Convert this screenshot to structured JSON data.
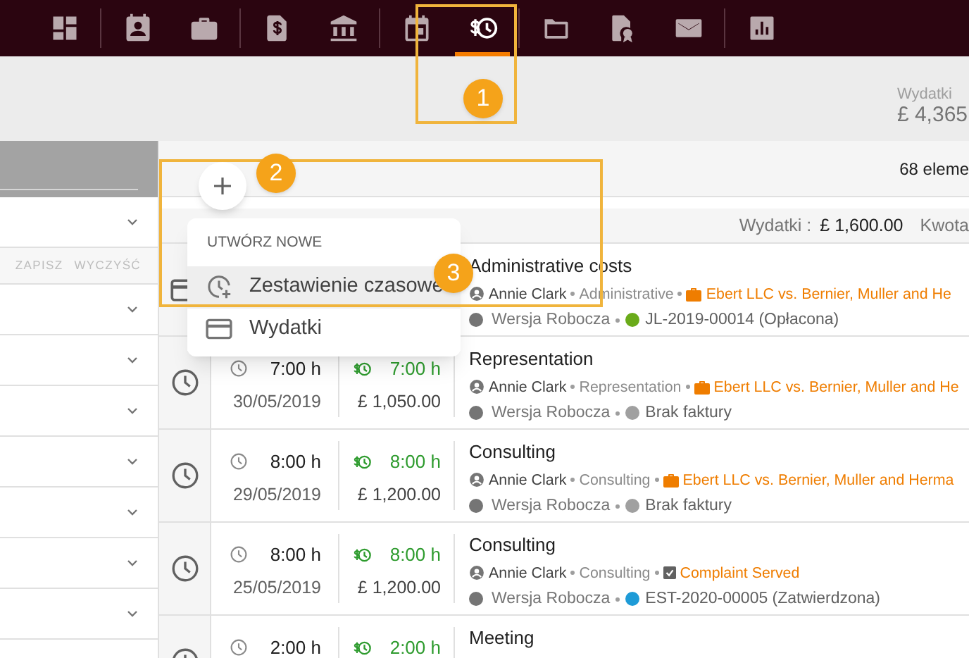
{
  "nav_groups": [
    [
      {
        "kind": "dashboard",
        "selected": false
      }
    ],
    [
      {
        "kind": "contacts",
        "selected": false
      },
      {
        "kind": "cases",
        "selected": false
      }
    ],
    [
      {
        "kind": "invoices",
        "selected": false
      },
      {
        "kind": "bank",
        "selected": false
      }
    ],
    [
      {
        "kind": "calendar",
        "selected": false
      },
      {
        "kind": "timesheets",
        "selected": true
      }
    ],
    [
      {
        "kind": "folder",
        "selected": false
      },
      {
        "kind": "certificate",
        "selected": false
      },
      {
        "kind": "mail",
        "selected": false
      }
    ],
    [
      {
        "kind": "reports",
        "selected": false
      }
    ]
  ],
  "header": {
    "label": "Wydatki",
    "value": "£ 4,365"
  },
  "sidebar": {
    "filters": [
      {
        "kind": "dropdown"
      },
      {
        "kind": "actions",
        "buttons": [
          "ZAPISZ",
          "WYCZYŚĆ"
        ]
      },
      {
        "kind": "dropdown"
      },
      {
        "kind": "dropdown"
      },
      {
        "kind": "dropdown"
      },
      {
        "kind": "dropdown"
      },
      {
        "kind": "dropdown"
      },
      {
        "kind": "dropdown"
      },
      {
        "kind": "dropdown"
      }
    ]
  },
  "toolbar": {
    "count": "68 eleme"
  },
  "summary": {
    "label": "Wydatki :",
    "value": "£ 1,600.00",
    "next_label": "Kwota"
  },
  "rows": [
    {
      "kind": "expense",
      "title": "Administrative costs",
      "user": "Annie Clark",
      "category": "Administrative",
      "matter": {
        "kind": "case",
        "label": "Ebert LLC vs. Bernier, Muller and He"
      },
      "status": "Wersja Robocza",
      "invoice": {
        "label": "JL-2019-00014 (Opłacona)",
        "color": "#6aab1a"
      }
    },
    {
      "kind": "time",
      "hours": "7:00 h",
      "date": "30/05/2019",
      "billable": "7:00 h",
      "amount": "£ 1,050.00",
      "title": "Representation",
      "user": "Annie Clark",
      "category": "Representation",
      "matter": {
        "kind": "case",
        "label": "Ebert LLC vs. Bernier, Muller and He"
      },
      "status": "Wersja Robocza",
      "invoice": {
        "label": "Brak faktury",
        "color": "#a0a0a0"
      }
    },
    {
      "kind": "time",
      "hours": "8:00 h",
      "date": "29/05/2019",
      "billable": "8:00 h",
      "amount": "£ 1,200.00",
      "title": "Consulting",
      "user": "Annie Clark",
      "category": "Consulting",
      "matter": {
        "kind": "case",
        "label": "Ebert LLC vs. Bernier, Muller and Herma"
      },
      "status": "Wersja Robocza",
      "invoice": {
        "label": "Brak faktury",
        "color": "#a0a0a0"
      }
    },
    {
      "kind": "time",
      "hours": "8:00 h",
      "date": "25/05/2019",
      "billable": "8:00 h",
      "amount": "£ 1,200.00",
      "title": "Consulting",
      "user": "Annie Clark",
      "category": "Consulting",
      "matter": {
        "kind": "task",
        "label": "Complaint Served"
      },
      "status": "Wersja Robocza",
      "invoice": {
        "label": "EST-2020-00005 (Zatwierdzona)",
        "color": "#1e9bd7"
      }
    },
    {
      "kind": "time",
      "hours": "2:00 h",
      "billable": "2:00 h",
      "title": "Meeting"
    }
  ],
  "menu": {
    "title": "UTWÓRZ NOWE",
    "items": [
      {
        "kind": "timesheet",
        "label": "Zestawienie czasowe",
        "selected": true
      },
      {
        "kind": "expense",
        "label": "Wydatki",
        "selected": false
      }
    ]
  },
  "annotations": [
    {
      "label": "1",
      "boxed": true
    },
    {
      "label": "2",
      "boxed": true
    },
    {
      "label": "3",
      "boxed": false
    }
  ]
}
